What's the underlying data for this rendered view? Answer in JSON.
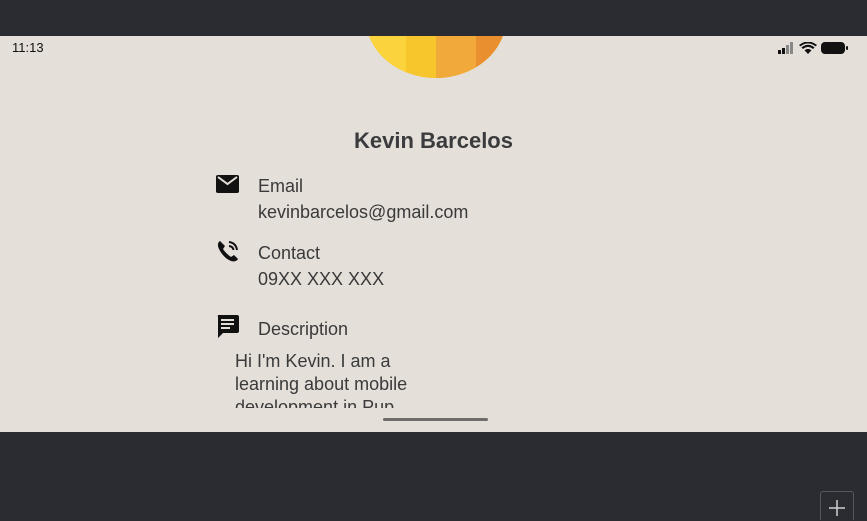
{
  "status_bar": {
    "time": "11:13",
    "icons": [
      "signal-icon",
      "wifi-icon",
      "battery-icon"
    ]
  },
  "profile": {
    "name": "Kevin Barcelos",
    "email_label": "Email",
    "email_value": "kevinbarcelos@gmail.com",
    "contact_label": "Contact",
    "contact_value": "09XX XXX XXX",
    "description_label": "Description",
    "description_text": "Hi I'm Kevin. I am a learning about mobile development in Pup"
  },
  "colors": {
    "screen_bg": "#e4dfd9",
    "frame_bg": "#2b2c32",
    "avatar_accent": "#f2b535",
    "text": "#3a3a3a"
  }
}
